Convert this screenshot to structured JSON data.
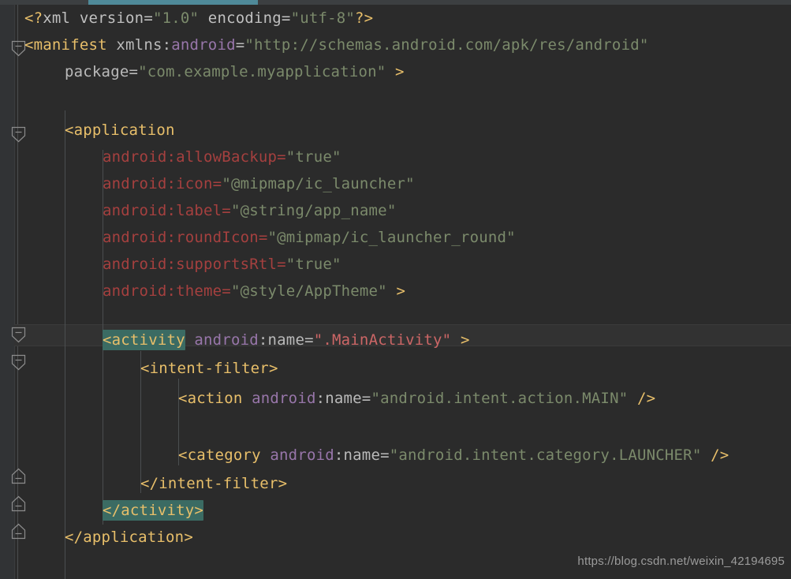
{
  "editor": {
    "accent_color": "#4f8a99",
    "background_color": "#2b2b2b",
    "gutter_color": "#313335",
    "highlight_color": "#3b6b63",
    "file_type": "AndroidManifest.xml"
  },
  "code": {
    "line1": {
      "p1": "<?",
      "p2": "xml",
      "p3": " version=",
      "p4": "\"1.0\"",
      "p5": " encoding=",
      "p6": "\"utf-8\"",
      "p7": "?>"
    },
    "line2": {
      "p1": "<",
      "p2": "manifest",
      "p3": " xmlns:",
      "p4": "android",
      "p5": "=",
      "p6": "\"http://schemas.android.com/apk/res/android\""
    },
    "line3": {
      "p1": "package=",
      "p2": "\"com.example.myapplication\"",
      "p3": " >"
    },
    "line4": {
      "p1": "<",
      "p2": "application"
    },
    "line5": {
      "p1": "android:allowBackup=",
      "p2": "\"true\""
    },
    "line6": {
      "p1": "android:icon=",
      "p2": "\"@mipmap/ic_launcher\""
    },
    "line7": {
      "p1": "android:label=",
      "p2": "\"@string/app_name\""
    },
    "line8": {
      "p1": "android:roundIcon=",
      "p2": "\"@mipmap/ic_launcher_round\""
    },
    "line9": {
      "p1": "android:supportsRtl=",
      "p2": "\"true\""
    },
    "line10": {
      "p1": "android:theme=",
      "p2": "\"@style/AppTheme\"",
      "p3": " >"
    },
    "line11": {
      "p1": "<activity",
      "p2": " android",
      "p3": ":name=",
      "p4": "\".MainActivity\"",
      "p5": " >"
    },
    "line12": {
      "p1": "<",
      "p2": "intent-filter",
      "p3": ">"
    },
    "line13": {
      "p1": "<",
      "p2": "action",
      "p3": " android",
      "p4": ":name=",
      "p5": "\"android.intent.action.MAIN\"",
      "p6": " />"
    },
    "line14": {
      "p1": "<",
      "p2": "category",
      "p3": " android",
      "p4": ":name=",
      "p5": "\"android.intent.category.LAUNCHER\"",
      "p6": " />"
    },
    "line15": {
      "p1": "</",
      "p2": "intent-filter",
      "p3": ">"
    },
    "line16": {
      "p1": "</activity>"
    },
    "line17": {
      "p1": "</",
      "p2": "application",
      "p3": ">"
    }
  },
  "watermark": {
    "text": "https://blog.csdn.net/weixin_42194695"
  }
}
